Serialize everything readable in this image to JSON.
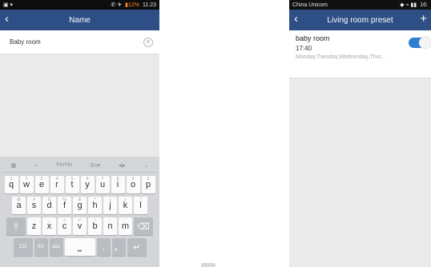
{
  "left": {
    "status": {
      "left": "▣ ▾",
      "right_icons": "✆ ✈",
      "battery": "▮12%",
      "time": "11:23"
    },
    "title": "Name",
    "back_icon": "back-icon",
    "name_value": "Baby room",
    "keyboard": {
      "toolbar": [
        "▦",
        "⌁",
        "PinYin",
        "En▾",
        "◂|▸",
        "⌄"
      ],
      "row1": [
        {
          "k": "q",
          "s": "1"
        },
        {
          "k": "w",
          "s": "2"
        },
        {
          "k": "e",
          "s": "3"
        },
        {
          "k": "r",
          "s": "4"
        },
        {
          "k": "t",
          "s": "5"
        },
        {
          "k": "y",
          "s": "6"
        },
        {
          "k": "u",
          "s": "7"
        },
        {
          "k": "i",
          "s": "8"
        },
        {
          "k": "o",
          "s": "9"
        },
        {
          "k": "p",
          "s": "0"
        }
      ],
      "row2": [
        {
          "k": "a",
          "s": "@"
        },
        {
          "k": "s",
          "s": "#"
        },
        {
          "k": "d",
          "s": "$"
        },
        {
          "k": "f",
          "s": "%"
        },
        {
          "k": "g",
          "s": "&"
        },
        {
          "k": "h",
          "s": "*"
        },
        {
          "k": "j",
          "s": "("
        },
        {
          "k": "k",
          "s": ")"
        },
        {
          "k": "l",
          "s": "!"
        }
      ],
      "row3": [
        {
          "k": "z",
          "s": "-"
        },
        {
          "k": "x",
          "s": "_"
        },
        {
          "k": "c",
          "s": "+"
        },
        {
          "k": "v",
          "s": "="
        },
        {
          "k": "b",
          "s": "/"
        },
        {
          "k": "n",
          "s": ";"
        },
        {
          "k": "m",
          "s": ":"
        }
      ],
      "shift": "⇧",
      "backspace": "⌫",
      "bottom": {
        "k123": "123",
        "lang": "En",
        "abc": "abc",
        "space": "⎵",
        "comma": ",",
        "period": "。",
        "enter": "↵"
      }
    }
  },
  "right": {
    "status": {
      "carrier": "China Unicom",
      "right_icons": "◆ ⌁ ▮▮",
      "time": "16:"
    },
    "title": "Living room preset",
    "add_icon": "+",
    "preset": {
      "name": "baby room",
      "time": "17:40",
      "days": "Monday,Tuesday,Wednesday,Thur...",
      "enabled": true
    }
  }
}
